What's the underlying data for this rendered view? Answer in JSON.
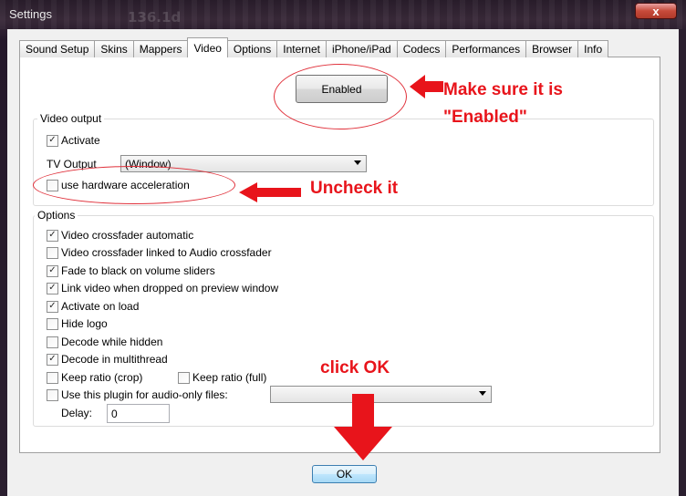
{
  "window": {
    "title": "Settings",
    "close_label": "x"
  },
  "tabs": [
    {
      "label": "Sound Setup",
      "active": false
    },
    {
      "label": "Skins",
      "active": false
    },
    {
      "label": "Mappers",
      "active": false
    },
    {
      "label": "Video",
      "active": true
    },
    {
      "label": "Options",
      "active": false
    },
    {
      "label": "Internet",
      "active": false
    },
    {
      "label": "iPhone/iPad",
      "active": false
    },
    {
      "label": "Codecs",
      "active": false
    },
    {
      "label": "Performances",
      "active": false
    },
    {
      "label": "Browser",
      "active": false
    },
    {
      "label": "Info",
      "active": false
    }
  ],
  "enabled_button": {
    "label": "Enabled"
  },
  "video_output": {
    "label": "Video output",
    "activate": {
      "label": "Activate",
      "checked": true
    },
    "tv_output": {
      "label": "TV Output",
      "value": "(Window)"
    },
    "hw_accel": {
      "label": "use hardware acceleration",
      "checked": false
    }
  },
  "options": {
    "label": "Options",
    "items": [
      {
        "label": "Video crossfader automatic",
        "checked": true
      },
      {
        "label": "Video crossfader linked to Audio crossfader",
        "checked": false
      },
      {
        "label": "Fade to black on volume sliders",
        "checked": true
      },
      {
        "label": "Link video when dropped on preview window",
        "checked": true
      },
      {
        "label": "Activate on load",
        "checked": true
      },
      {
        "label": "Hide logo",
        "checked": false
      },
      {
        "label": "Decode while hidden",
        "checked": false
      },
      {
        "label": "Decode in multithread",
        "checked": true
      }
    ],
    "keep_ratio_crop": {
      "label": "Keep ratio (crop)",
      "checked": false
    },
    "keep_ratio_full": {
      "label": "Keep ratio (full)",
      "checked": false
    },
    "audio_plugin": {
      "label": "Use this plugin for audio-only files:",
      "checked": false,
      "value": ""
    },
    "delay": {
      "label": "Delay:",
      "value": "0"
    }
  },
  "ok_button": {
    "label": "OK"
  },
  "annotations": {
    "enabled_note_line1": "Make sure it is",
    "enabled_note_line2": "\"Enabled\"",
    "uncheck_note": "Uncheck it",
    "ok_note": "click OK",
    "color": "#e8141b"
  },
  "background_text": "136.1d"
}
